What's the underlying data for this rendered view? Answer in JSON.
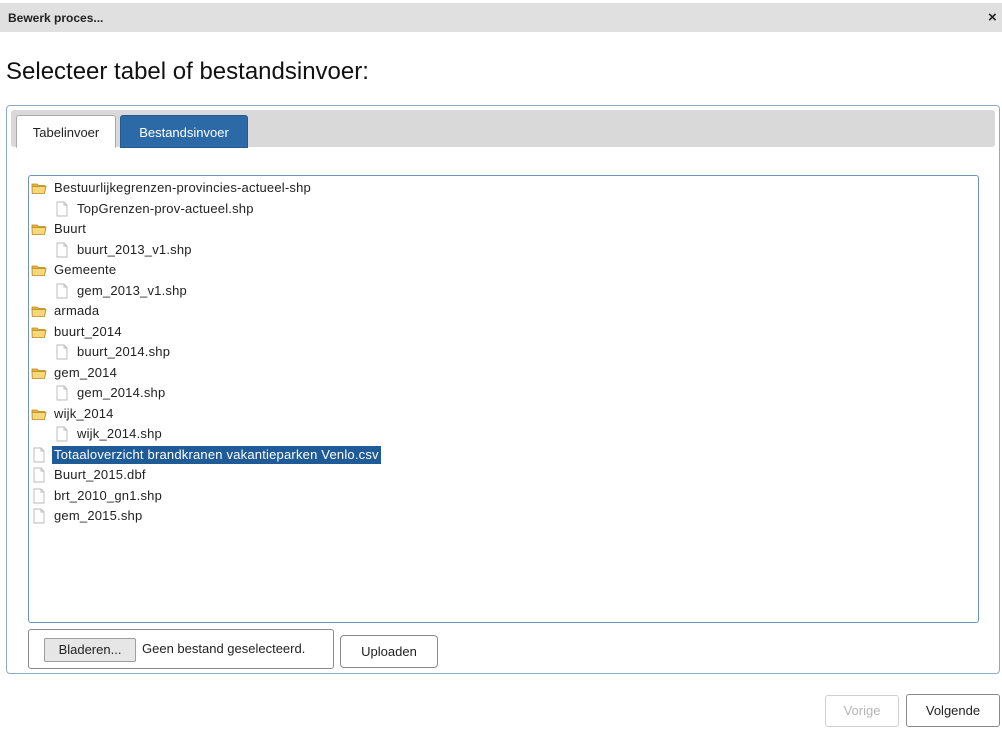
{
  "dialog": {
    "title": "Bewerk proces...",
    "close_glyph": "×",
    "heading": "Selecteer tabel of bestandsinvoer:"
  },
  "tabs": [
    {
      "label": "Tabelinvoer",
      "active": true
    },
    {
      "label": "Bestandsinvoer",
      "active": false
    }
  ],
  "tree": {
    "items": [
      {
        "label": "Bestuurlijkegrenzen-provincies-actueel-shp",
        "type": "folder",
        "level": 0,
        "icon": "folder-open-icon"
      },
      {
        "label": "TopGrenzen-prov-actueel.shp",
        "type": "file",
        "level": 1,
        "icon": "file-icon"
      },
      {
        "label": "Buurt",
        "type": "folder",
        "level": 0,
        "icon": "folder-open-icon"
      },
      {
        "label": "buurt_2013_v1.shp",
        "type": "file",
        "level": 1,
        "icon": "file-icon"
      },
      {
        "label": "Gemeente",
        "type": "folder",
        "level": 0,
        "icon": "folder-open-icon"
      },
      {
        "label": "gem_2013_v1.shp",
        "type": "file",
        "level": 1,
        "icon": "file-icon"
      },
      {
        "label": "armada",
        "type": "folder",
        "level": 0,
        "icon": "folder-open-icon"
      },
      {
        "label": "buurt_2014",
        "type": "folder",
        "level": 0,
        "icon": "folder-open-icon"
      },
      {
        "label": "buurt_2014.shp",
        "type": "file",
        "level": 1,
        "icon": "file-icon"
      },
      {
        "label": "gem_2014",
        "type": "folder",
        "level": 0,
        "icon": "folder-open-icon"
      },
      {
        "label": "gem_2014.shp",
        "type": "file",
        "level": 1,
        "icon": "file-icon"
      },
      {
        "label": "wijk_2014",
        "type": "folder",
        "level": 0,
        "icon": "folder-open-icon"
      },
      {
        "label": "wijk_2014.shp",
        "type": "file",
        "level": 1,
        "icon": "file-icon"
      },
      {
        "label": "Totaaloverzicht brandkranen vakantieparken Venlo.csv",
        "type": "file",
        "level": 0,
        "icon": "file-icon",
        "selected": true
      },
      {
        "label": "Buurt_2015.dbf",
        "type": "file",
        "level": 0,
        "icon": "file-icon"
      },
      {
        "label": "brt_2010_gn1.shp",
        "type": "file",
        "level": 0,
        "icon": "file-icon"
      },
      {
        "label": "gem_2015.shp",
        "type": "file",
        "level": 0,
        "icon": "file-icon"
      }
    ]
  },
  "file_input": {
    "browse_label": "Bladeren...",
    "status": "Geen bestand geselecteerd."
  },
  "upload_label": "Uploaden",
  "footer": {
    "prev_label": "Vorige",
    "next_label": "Volgende"
  },
  "colors": {
    "accent": "#2b6aa6",
    "selection": "#1f5b96",
    "folder": "#f2c94c"
  }
}
